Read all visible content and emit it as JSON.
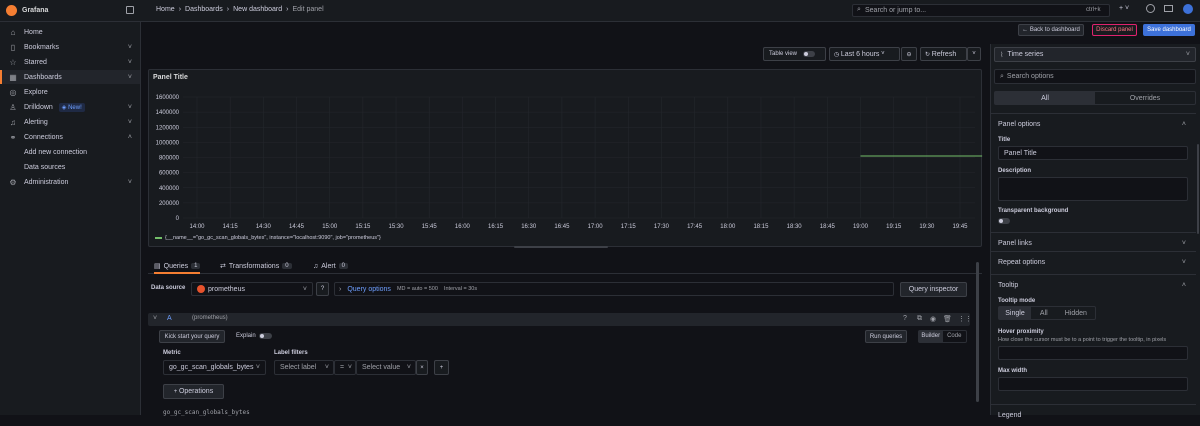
{
  "app": {
    "name": "Grafana"
  },
  "breadcrumb": [
    "Home",
    "Dashboards",
    "New dashboard",
    "Edit panel"
  ],
  "search": {
    "placeholder": "Search or jump to...",
    "shortcut": "ctrl+k"
  },
  "topbar": {
    "plus": "+"
  },
  "actions": {
    "back": "Back to dashboard",
    "discard": "Discard panel",
    "save": "Save dashboard"
  },
  "sidebar": {
    "items": [
      {
        "label": "Home",
        "icon": "home-icon"
      },
      {
        "label": "Bookmarks",
        "icon": "bookmark-icon"
      },
      {
        "label": "Starred",
        "icon": "star-icon"
      },
      {
        "label": "Dashboards",
        "icon": "dashboards-icon"
      },
      {
        "label": "Explore",
        "icon": "compass-icon"
      },
      {
        "label": "Drilldown",
        "icon": "drilldown-icon",
        "badge": "New!"
      },
      {
        "label": "Alerting",
        "icon": "bell-icon"
      },
      {
        "label": "Connections",
        "icon": "connections-icon"
      },
      {
        "label": "Add new connection"
      },
      {
        "label": "Data sources"
      },
      {
        "label": "Administration",
        "icon": "gear-icon"
      }
    ]
  },
  "toolbar": {
    "table_view": "Table view",
    "time_range": "Last 6 hours",
    "refresh": "Refresh"
  },
  "panel": {
    "title": "Panel Title",
    "legend": "{__name__=\"go_gc_scan_globals_bytes\", instance=\"localhost:9090\", job=\"prometheus\"}"
  },
  "chart_data": {
    "type": "line",
    "title": "Panel Title",
    "y_ticks": [
      "1600000",
      "1400000",
      "1200000",
      "1000000",
      "800000",
      "600000",
      "400000",
      "200000",
      "0"
    ],
    "x_ticks": [
      "14:00",
      "14:15",
      "14:30",
      "14:45",
      "15:00",
      "15:15",
      "15:30",
      "15:45",
      "16:00",
      "16:15",
      "16:30",
      "16:45",
      "17:00",
      "17:15",
      "17:30",
      "17:45",
      "18:00",
      "18:15",
      "18:30",
      "18:45",
      "19:00",
      "19:15",
      "19:30",
      "19:45"
    ],
    "ylim": [
      0,
      1600000
    ],
    "series": [
      {
        "name": "{__name__=\"go_gc_scan_globals_bytes\", instance=\"localhost:9090\", job=\"prometheus\"}",
        "color": "#73bf69",
        "x_range": [
          "19:00",
          "19:55"
        ],
        "values": [
          820000,
          820000
        ]
      }
    ]
  },
  "tabs": [
    {
      "label": "Queries",
      "count": "1"
    },
    {
      "label": "Transformations",
      "count": "0"
    },
    {
      "label": "Alert",
      "count": "0"
    }
  ],
  "query": {
    "datasource_label": "Data source",
    "datasource": "prometheus",
    "options_label": "Query options",
    "options_meta": "MD = auto = 500",
    "interval": "Interval = 30s",
    "inspector": "Query inspector",
    "ref": "A",
    "ref_ds": "(prometheus)",
    "kickstart": "Kick start your query",
    "explain": "Explain",
    "run": "Run queries",
    "builder": "Builder",
    "code": "Code",
    "metric_label": "Metric",
    "metric_value": "go_gc_scan_globals_bytes",
    "label_filters": "Label filters",
    "select_label": "Select label",
    "op": "=",
    "select_value": "Select value",
    "operations": "Operations",
    "preview": "go_gc_scan_globals_bytes"
  },
  "options_pane": {
    "viz": "Time series",
    "search_placeholder": "Search options",
    "tab_all": "All",
    "tab_overrides": "Overrides",
    "panel_options": "Panel options",
    "title_label": "Title",
    "title_value": "Panel Title",
    "desc_label": "Description",
    "transparent_label": "Transparent background",
    "panel_links": "Panel links",
    "repeat_options": "Repeat options",
    "tooltip": "Tooltip",
    "tooltip_mode": "Tooltip mode",
    "mode_single": "Single",
    "mode_all": "All",
    "mode_hidden": "Hidden",
    "hover_label": "Hover proximity",
    "hover_desc": "How close the cursor must be to a point to trigger the tooltip, in pixels",
    "max_width": "Max width",
    "legend": "Legend"
  },
  "colors": {
    "accent": "#f57e32",
    "primary": "#3d71d9",
    "danger": "#e0226e",
    "series": "#73bf69"
  }
}
